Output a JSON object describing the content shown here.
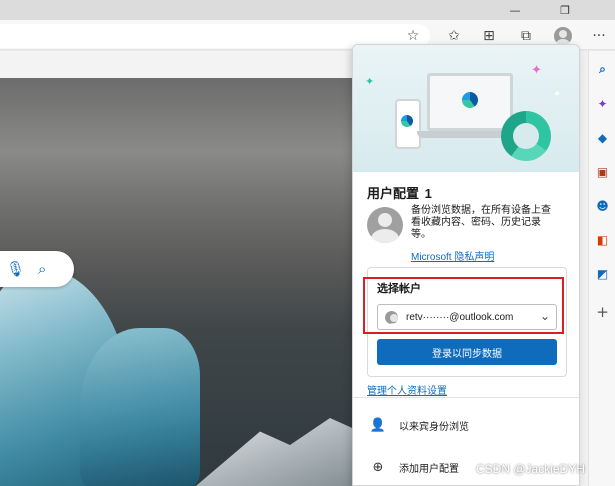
{
  "window": {
    "minimize_glyph": "—",
    "restore_glyph": "❐",
    "close_glyph": "✕"
  },
  "toolbar": {
    "icons": [
      "add-favorite-icon",
      "favorites-icon",
      "collections-icon",
      "extensions-icon",
      "profile-icon",
      "more-icon"
    ],
    "more_glyph": "···"
  },
  "search": {
    "icons": [
      "microphone-icon",
      "search-icon"
    ]
  },
  "sidebar": {
    "icons": [
      "search-icon",
      "sparkle-icon",
      "shopping-tag-icon",
      "toolbox-icon",
      "people-icon",
      "office-icon",
      "outlook-icon",
      "add-icon"
    ],
    "colors": {
      "accent": "#0f6cbd",
      "office": "#d83b01",
      "outlook": "#0f6cbd",
      "sparkle": "#7a3bd0"
    }
  },
  "profile_panel": {
    "title": "用户配置",
    "count": "1",
    "sync_description": "备份浏览数据，在所有设备上查看收藏内容、密码、历史记录等。",
    "privacy_link": "Microsoft 隐私声明",
    "account_section": {
      "label": "选择帐户",
      "selected_account": "retv········@outlook.com",
      "signin_button": "登录以同步数据"
    },
    "manage_link": "管理个人资料设置",
    "menu_items": [
      {
        "label": "以来宾身份浏览",
        "icon": "guest-person-icon"
      },
      {
        "label": "添加用户配置",
        "icon": "add-circle-icon"
      }
    ]
  },
  "watermark": "CSDN @JackieDYH"
}
